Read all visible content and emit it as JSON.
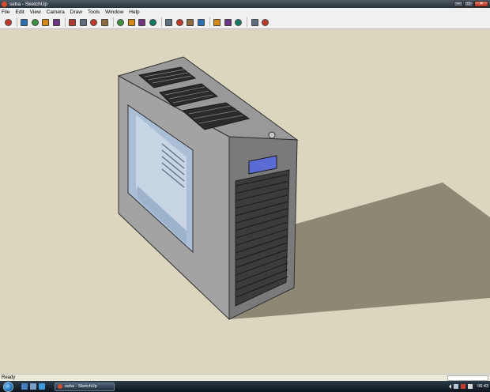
{
  "window": {
    "title": "seba - SketchUp"
  },
  "menu": [
    "File",
    "Edit",
    "View",
    "Camera",
    "Draw",
    "Tools",
    "Window",
    "Help"
  ],
  "toolbar": {
    "tools": [
      "select-tool",
      "sep",
      "line-tool",
      "rectangle-tool",
      "circle-tool",
      "arc-tool",
      "sep",
      "make-component-tool",
      "eraser-tool",
      "tape-measure-tool",
      "paint-bucket-tool",
      "sep",
      "push-pull-tool",
      "move-tool",
      "rotate-tool",
      "offset-tool",
      "sep",
      "orbit-tool",
      "pan-tool",
      "zoom-tool",
      "zoom-extents-tool",
      "sep",
      "google-earth-tool",
      "get-models-tool",
      "share-model-tool",
      "sep",
      "components-tool",
      "get-photo-texture-tool"
    ]
  },
  "status": {
    "text": "Ready"
  },
  "taskbar": {
    "task_label": "seba - SketchUp",
    "clock": "06:43"
  },
  "colors": {
    "viewport": "#dcd6bf",
    "shadow": "#8d8774",
    "case_side": "#a3a3a3",
    "case_top": "#999999",
    "case_front": "#7a7a7a",
    "window_glass": "#aabfd6",
    "display": "#5a6bd6"
  }
}
